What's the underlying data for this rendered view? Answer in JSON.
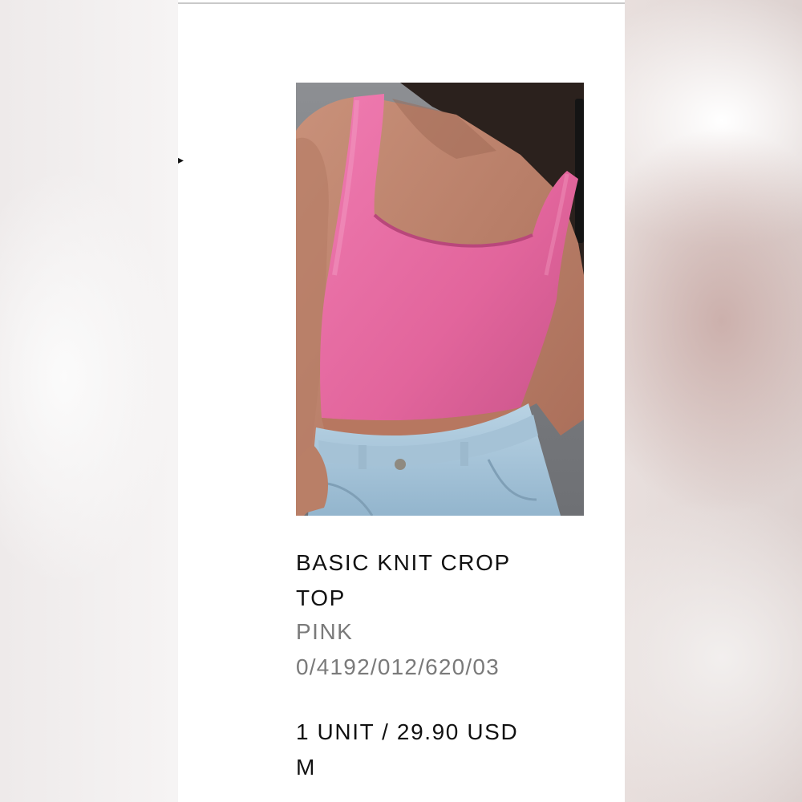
{
  "product": {
    "name": "BASIC KNIT CROP TOP",
    "color": "PINK",
    "reference": "0/4192/012/620/03",
    "quantity_price": "1 UNIT / 29.90 USD",
    "size": "M",
    "image_alt": "Pink knit crop top worn with light denim jeans"
  },
  "colors": {
    "garment": "#e56aa0",
    "denim": "#a9c7dc",
    "background_gray": "#85878b"
  },
  "icons": {
    "edge_arrow": "chevron-right-icon"
  }
}
